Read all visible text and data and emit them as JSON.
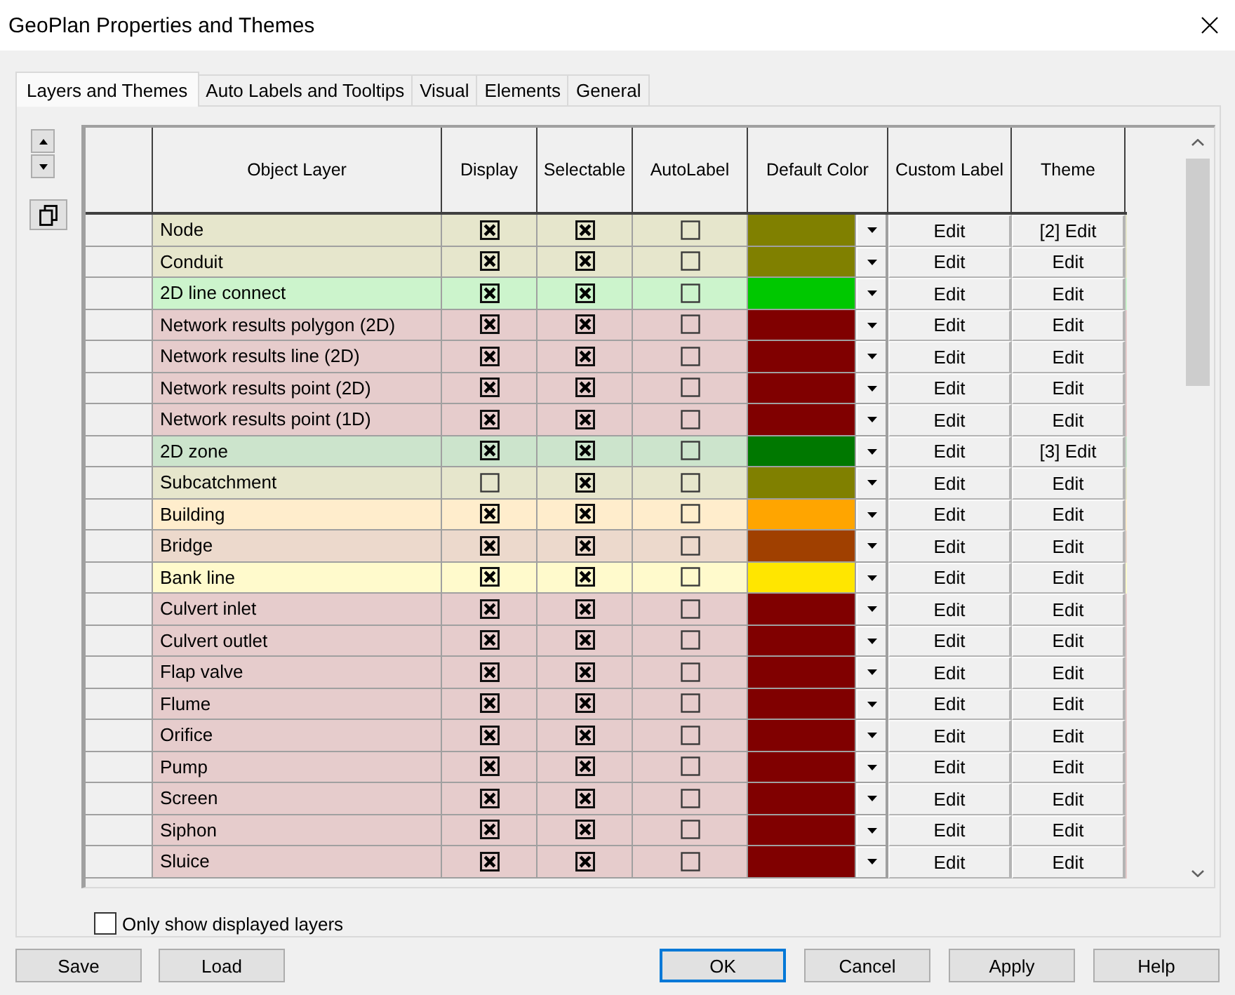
{
  "window": {
    "title": "GeoPlan Properties and Themes"
  },
  "tabs": [
    {
      "label": "Layers and Themes",
      "selected": true
    },
    {
      "label": "Auto Labels and Tooltips",
      "selected": false
    },
    {
      "label": "Visual",
      "selected": false
    },
    {
      "label": "Elements",
      "selected": false
    },
    {
      "label": "General",
      "selected": false
    }
  ],
  "layers_table": {
    "columns": [
      "Object Layer",
      "Display",
      "Selectable",
      "AutoLabel",
      "Default Color",
      "Custom Label",
      "Theme"
    ],
    "rows": [
      {
        "name": "Node",
        "display": true,
        "selectable": true,
        "autolabel": false,
        "color": "#808000",
        "custom_label": "Edit",
        "theme": "[2] Edit"
      },
      {
        "name": "Conduit",
        "display": true,
        "selectable": true,
        "autolabel": false,
        "color": "#808000",
        "custom_label": "Edit",
        "theme": "Edit"
      },
      {
        "name": "2D line connect",
        "display": true,
        "selectable": true,
        "autolabel": false,
        "color": "#00c800",
        "custom_label": "Edit",
        "theme": "Edit"
      },
      {
        "name": "Network results polygon (2D)",
        "display": true,
        "selectable": true,
        "autolabel": false,
        "color": "#800000",
        "custom_label": "Edit",
        "theme": "Edit"
      },
      {
        "name": "Network results line (2D)",
        "display": true,
        "selectable": true,
        "autolabel": false,
        "color": "#800000",
        "custom_label": "Edit",
        "theme": "Edit"
      },
      {
        "name": "Network results point (2D)",
        "display": true,
        "selectable": true,
        "autolabel": false,
        "color": "#800000",
        "custom_label": "Edit",
        "theme": "Edit"
      },
      {
        "name": "Network results point (1D)",
        "display": true,
        "selectable": true,
        "autolabel": false,
        "color": "#800000",
        "custom_label": "Edit",
        "theme": "Edit"
      },
      {
        "name": "2D zone",
        "display": true,
        "selectable": true,
        "autolabel": false,
        "color": "#007800",
        "custom_label": "Edit",
        "theme": "[3] Edit"
      },
      {
        "name": "Subcatchment",
        "display": false,
        "selectable": true,
        "autolabel": false,
        "color": "#808000",
        "custom_label": "Edit",
        "theme": "Edit"
      },
      {
        "name": "Building",
        "display": true,
        "selectable": true,
        "autolabel": false,
        "color": "#ffa500",
        "custom_label": "Edit",
        "theme": "Edit"
      },
      {
        "name": "Bridge",
        "display": true,
        "selectable": true,
        "autolabel": false,
        "color": "#a04000",
        "custom_label": "Edit",
        "theme": "Edit"
      },
      {
        "name": "Bank line",
        "display": true,
        "selectable": true,
        "autolabel": false,
        "color": "#ffe600",
        "custom_label": "Edit",
        "theme": "Edit"
      },
      {
        "name": "Culvert inlet",
        "display": true,
        "selectable": true,
        "autolabel": false,
        "color": "#800000",
        "custom_label": "Edit",
        "theme": "Edit"
      },
      {
        "name": "Culvert outlet",
        "display": true,
        "selectable": true,
        "autolabel": false,
        "color": "#800000",
        "custom_label": "Edit",
        "theme": "Edit"
      },
      {
        "name": "Flap valve",
        "display": true,
        "selectable": true,
        "autolabel": false,
        "color": "#800000",
        "custom_label": "Edit",
        "theme": "Edit"
      },
      {
        "name": "Flume",
        "display": true,
        "selectable": true,
        "autolabel": false,
        "color": "#800000",
        "custom_label": "Edit",
        "theme": "Edit"
      },
      {
        "name": "Orifice",
        "display": true,
        "selectable": true,
        "autolabel": false,
        "color": "#800000",
        "custom_label": "Edit",
        "theme": "Edit"
      },
      {
        "name": "Pump",
        "display": true,
        "selectable": true,
        "autolabel": false,
        "color": "#800000",
        "custom_label": "Edit",
        "theme": "Edit"
      },
      {
        "name": "Screen",
        "display": true,
        "selectable": true,
        "autolabel": false,
        "color": "#800000",
        "custom_label": "Edit",
        "theme": "Edit"
      },
      {
        "name": "Siphon",
        "display": true,
        "selectable": true,
        "autolabel": false,
        "color": "#800000",
        "custom_label": "Edit",
        "theme": "Edit"
      },
      {
        "name": "Sluice",
        "display": true,
        "selectable": true,
        "autolabel": false,
        "color": "#800000",
        "custom_label": "Edit",
        "theme": "Edit"
      }
    ]
  },
  "only_show_displayed_layers": {
    "label": "Only show displayed layers",
    "checked": false
  },
  "file_buttons": [
    {
      "label": "Save"
    },
    {
      "label": "Load"
    }
  ],
  "dialog_buttons": [
    {
      "label": "OK",
      "default": true
    },
    {
      "label": "Cancel",
      "default": false
    },
    {
      "label": "Apply",
      "default": false
    },
    {
      "label": "Help",
      "default": false
    }
  ]
}
